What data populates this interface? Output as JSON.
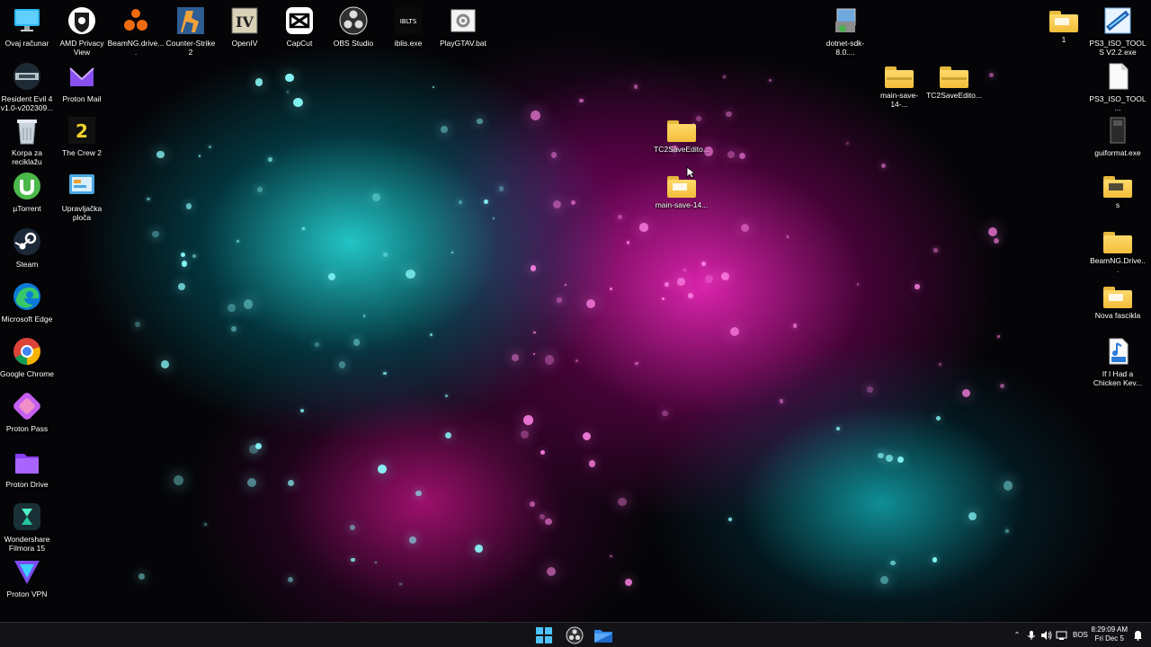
{
  "desktop": {
    "icons": [
      {
        "label": "Ovaj računar",
        "icon": "monitor-icon"
      },
      {
        "label": "AMD Privacy View",
        "icon": "amd-privacy-icon"
      },
      {
        "label": "BeamNG.drive....",
        "icon": "beamng-icon"
      },
      {
        "label": "Counter-Strike 2",
        "icon": "counter-strike-icon"
      },
      {
        "label": "OpenIV",
        "icon": "openiv-icon"
      },
      {
        "label": "CapCut",
        "icon": "capcut-icon"
      },
      {
        "label": "OBS Studio",
        "icon": "obs-icon"
      },
      {
        "label": "iblis.exe",
        "icon": "iblis-icon"
      },
      {
        "label": "PlayGTAV.bat",
        "icon": "batch-file-icon"
      },
      {
        "label": "dotnet-sdk-8.0....",
        "icon": "installer-icon"
      },
      {
        "label": "1",
        "icon": "folder-icon"
      },
      {
        "label": "PS3_ISO_TOOLS V2.2.exe",
        "icon": "ps3-iso-icon"
      },
      {
        "label": "Resident Evil 4 v1.0-v202309...",
        "icon": "trainer-icon"
      },
      {
        "label": "Proton Mail",
        "icon": "proton-mail-icon"
      },
      {
        "label": "main-save-14-...",
        "icon": "zip-folder-icon"
      },
      {
        "label": "TC2SaveEdito...",
        "icon": "zip-folder-icon"
      },
      {
        "label": "PS3_ISO_TOOL...",
        "icon": "file-icon"
      },
      {
        "label": "Korpa za reciklažu",
        "icon": "recycle-bin-icon"
      },
      {
        "label": "The Crew 2",
        "icon": "the-crew-icon"
      },
      {
        "label": "TC2SaveEdito...",
        "icon": "folder-icon"
      },
      {
        "label": "guiformat.exe",
        "icon": "exe-icon"
      },
      {
        "label": "µTorrent",
        "icon": "utorrent-icon"
      },
      {
        "label": "Upravljačka ploča",
        "icon": "control-panel-icon"
      },
      {
        "label": "main-save-14...",
        "icon": "folder-icon"
      },
      {
        "label": "s",
        "icon": "folder-icon"
      },
      {
        "label": "Steam",
        "icon": "steam-icon"
      },
      {
        "label": "BeamNG.Drive...",
        "icon": "folder-icon"
      },
      {
        "label": "Microsoft Edge",
        "icon": "edge-icon"
      },
      {
        "label": "Nova fascikla",
        "icon": "folder-icon"
      },
      {
        "label": "Google Chrome",
        "icon": "chrome-icon"
      },
      {
        "label": "If I Had a Chicken  Kev...",
        "icon": "mp3-icon"
      },
      {
        "label": "Proton Pass",
        "icon": "proton-pass-icon"
      },
      {
        "label": "Proton Drive",
        "icon": "proton-drive-icon"
      },
      {
        "label": "Wondershare Filmora 15",
        "icon": "filmora-icon"
      },
      {
        "label": "Proton VPN",
        "icon": "proton-vpn-icon"
      }
    ]
  },
  "taskbar": {
    "language": "BOS",
    "time": "8:29:09 AM",
    "date": "Fri Dec 5",
    "start_icon": "windows-start-icon",
    "pinned": [
      "obs-icon",
      "file-explorer-icon"
    ]
  },
  "colors": {
    "accent_cyan": "#27e3e0",
    "accent_magenta": "#ff2ac8",
    "taskbar": "#141418"
  }
}
